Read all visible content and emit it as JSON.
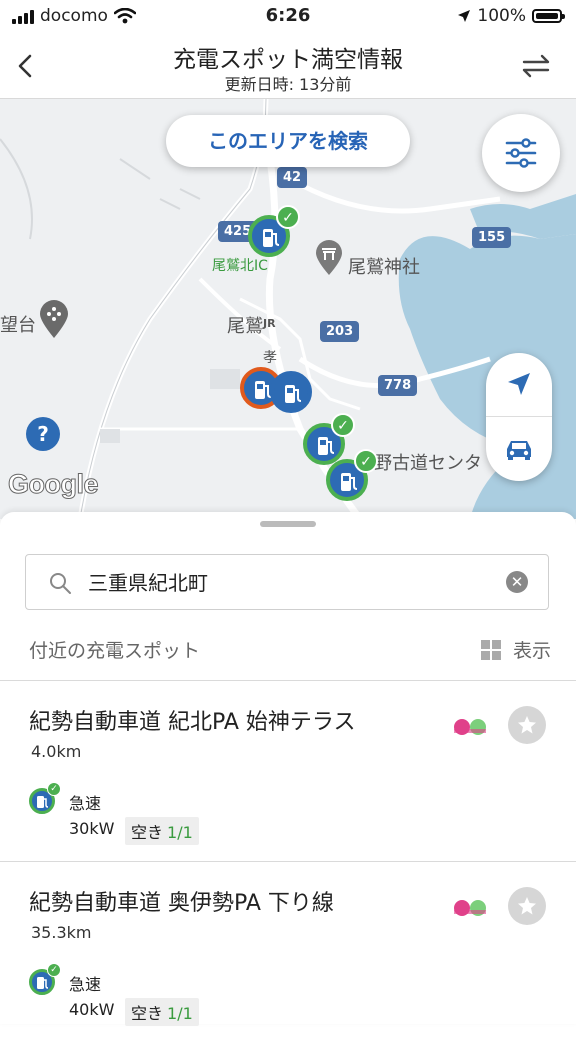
{
  "status_bar": {
    "carrier": "docomo",
    "time": "6:26",
    "battery": "100%"
  },
  "header": {
    "title": "充電スポット満空情報",
    "subtitle": "更新日時: 13分前"
  },
  "map": {
    "search_area_button": "このエリアを検索",
    "labels": [
      "尾鷲神社",
      "尾鷲",
      "尾鷲北IC",
      "望台",
      "野古道センタ",
      "孝"
    ],
    "road_numbers": [
      "42",
      "425",
      "155",
      "203",
      "778"
    ],
    "help": "?",
    "attribution": "Google",
    "colors": {
      "water": "#aacde0",
      "land": "#eef0f2",
      "pin_blue": "#2d6bb4",
      "available_green": "#4caf50",
      "occupied_orange": "#e05a1d"
    }
  },
  "sheet": {
    "search": {
      "value": "三重県紀北町",
      "placeholder": ""
    },
    "nearby_label": "付近の充電スポット",
    "display_label": "表示",
    "spots": [
      {
        "name": "紀勢自動車道 紀北PA 始神テラス",
        "distance": "4.0km",
        "type": "急速",
        "power": "30kW",
        "availability_label": "空き",
        "availability": "1/1"
      },
      {
        "name": "紀勢自動車道 奥伊勢PA 下り線",
        "distance": "35.3km",
        "type": "急速",
        "power": "40kW",
        "availability_label": "空き",
        "availability": "1/1"
      }
    ]
  }
}
